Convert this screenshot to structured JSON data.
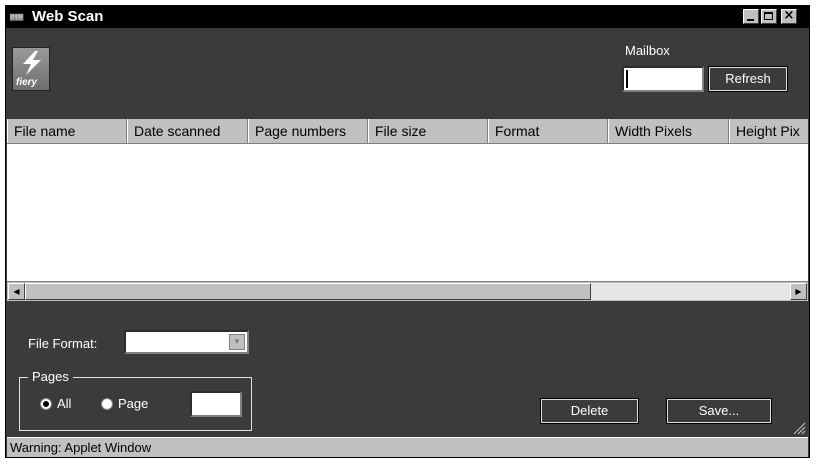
{
  "window": {
    "title": "Web Scan",
    "close_glyph": "×"
  },
  "logo": {
    "text": "fiery"
  },
  "mailbox": {
    "label": "Mailbox",
    "value": "",
    "refresh_label": "Refresh"
  },
  "table": {
    "columns": [
      "File name",
      "Date scanned",
      "Page numbers",
      "File size",
      "Format",
      "Width Pixels",
      "Height Pix"
    ],
    "rows": []
  },
  "file_format": {
    "label": "File Format:",
    "selected": ""
  },
  "pages": {
    "legend": "Pages",
    "option_all": "All",
    "option_page": "Page",
    "page_value": ""
  },
  "actions": {
    "delete_label": "Delete",
    "save_label": "Save..."
  },
  "status": {
    "text": "Warning: Applet Window"
  },
  "colors": {
    "panel": "#3b3b3b",
    "titlebar": "#000000",
    "header": "#c0c0c0"
  }
}
